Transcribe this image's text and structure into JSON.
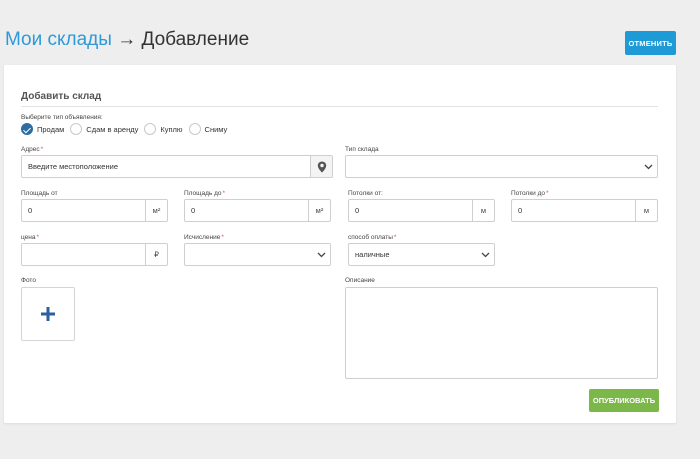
{
  "breadcrumb": {
    "parent": "Мои склады",
    "arrow": "→",
    "current": "Добавление"
  },
  "header": {
    "cancel_label": "ОТМЕНИТЬ"
  },
  "form": {
    "section_title": "Добавить склад",
    "listing_type": {
      "label": "Выберите тип объявления:",
      "options": [
        "Продам",
        "Сдам в аренду",
        "Куплю",
        "Сниму"
      ],
      "selected": "Продам"
    },
    "address": {
      "label": "Адрес",
      "required_mark": "*",
      "placeholder": "Введите местоположение",
      "value": ""
    },
    "warehouse_type": {
      "label": "Тип склада",
      "value": ""
    },
    "area_from": {
      "label": "Площадь от",
      "value": "0",
      "unit": "м²"
    },
    "area_to": {
      "label": "Площадь до",
      "required_mark": "*",
      "value": "0",
      "unit": "м²"
    },
    "ceiling_from": {
      "label": "Потолки от:",
      "value": "0",
      "unit": "м"
    },
    "ceiling_to": {
      "label": "Потолки до",
      "required_mark": "*",
      "value": "0",
      "unit": "м"
    },
    "price": {
      "label": "цена",
      "required_mark": "*",
      "value": "",
      "unit": "₽"
    },
    "calculation": {
      "label": "Исчисление",
      "required_mark": "*",
      "value": ""
    },
    "payment": {
      "label": "способ оплаты",
      "required_mark": "*",
      "value": "наличные"
    },
    "photo": {
      "label": "Фото"
    },
    "description": {
      "label": "Описание",
      "value": ""
    },
    "publish_label": "ОПУБЛИКОВАТЬ"
  },
  "colors": {
    "accent": "#2c9ad8",
    "cancel_button": "#1e9ad6",
    "publish_button": "#7cb749",
    "radio_checked": "#2c6da4",
    "background": "#eeeeee"
  },
  "icons": {
    "location": "map-pin-icon",
    "dropdown": "chevron-down-icon",
    "photo_add": "plus-icon",
    "radio_checked": "checkmark-icon"
  }
}
